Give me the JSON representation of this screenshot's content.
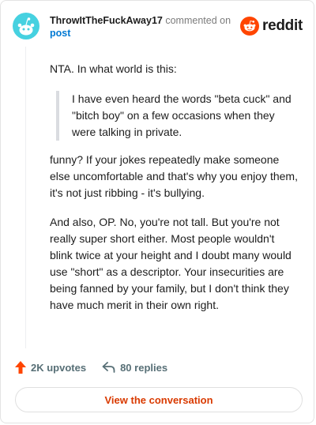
{
  "header": {
    "author": "ThrowItTheFuckAway17",
    "commented_text": "commented on",
    "post_link": "post",
    "brand": "reddit"
  },
  "comment": {
    "intro": "NTA. In what world is this:",
    "quote": "I have even heard the words \"beta cuck\" and \"bitch boy\" on a few occasions when they were talking in private.",
    "paragraphs": [
      "funny? If your jokes repeatedly make someone else uncomfortable and that's why you enjoy them, it's not just ribbing - it's bullying.",
      "And also, OP. No, you're not tall. But you're not really super short either. Most people wouldn't blink twice at your height and I doubt many would use \"short\" as a descriptor. Your insecurities are being fanned by your family, but I don't think they have much merit in their own right."
    ]
  },
  "actions": {
    "upvotes": "2K upvotes",
    "replies": "80 replies"
  },
  "cta": {
    "label": "View the conversation"
  },
  "icons": {
    "avatar": "snoo-avatar-icon",
    "brand": "reddit-logo-icon",
    "upvote": "upvote-arrow-icon",
    "reply": "reply-arrow-icon"
  },
  "colors": {
    "brand_orange": "#ff4500",
    "link_blue": "#0079d3",
    "cta_text": "#d93a00",
    "avatar_bg": "#46d1e0"
  }
}
